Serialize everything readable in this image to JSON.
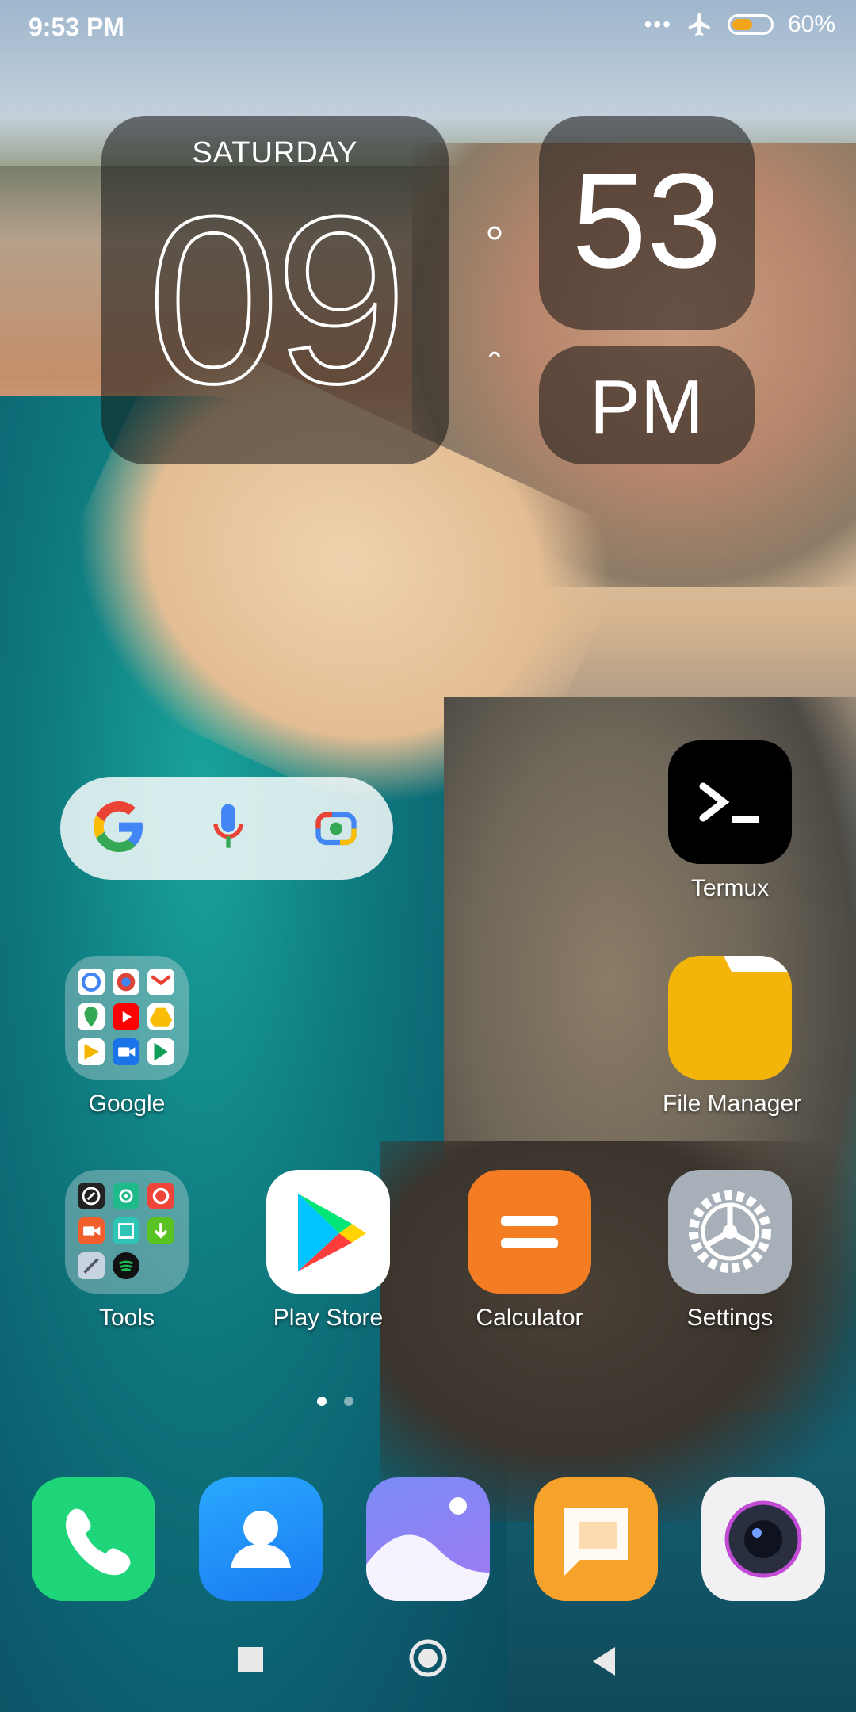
{
  "status_bar": {
    "time": "9:53 PM",
    "more": "•••",
    "battery_percent": "60%",
    "battery_level": 0.6
  },
  "clock_widget": {
    "day": "SATURDAY",
    "hour": "09",
    "minute": "53",
    "ampm": "PM"
  },
  "search_widget": {
    "icons": [
      "google-g-icon",
      "microphone-icon",
      "lens-camera-icon"
    ]
  },
  "home": {
    "apps": [
      {
        "label": "Termux"
      },
      {
        "label": "Google"
      },
      {
        "label": "File Manager"
      },
      {
        "label": "Tools"
      },
      {
        "label": "Play Store"
      },
      {
        "label": "Calculator"
      },
      {
        "label": "Settings"
      }
    ]
  },
  "pager": {
    "pages": 2,
    "active": 1
  },
  "dock": [
    "phone-icon",
    "contacts-icon",
    "gallery-icon",
    "messages-icon",
    "camera-icon"
  ],
  "navigation": [
    "recents-button",
    "home-button",
    "back-button"
  ],
  "colors": {
    "battery": "#f2a41a",
    "termux_bg": "#000000",
    "file_manager": "#f4b50a",
    "calculator": "#f47c22",
    "settings": "#a7b0b8",
    "phone": "#1fd57a",
    "contacts": "#1c95f5"
  }
}
